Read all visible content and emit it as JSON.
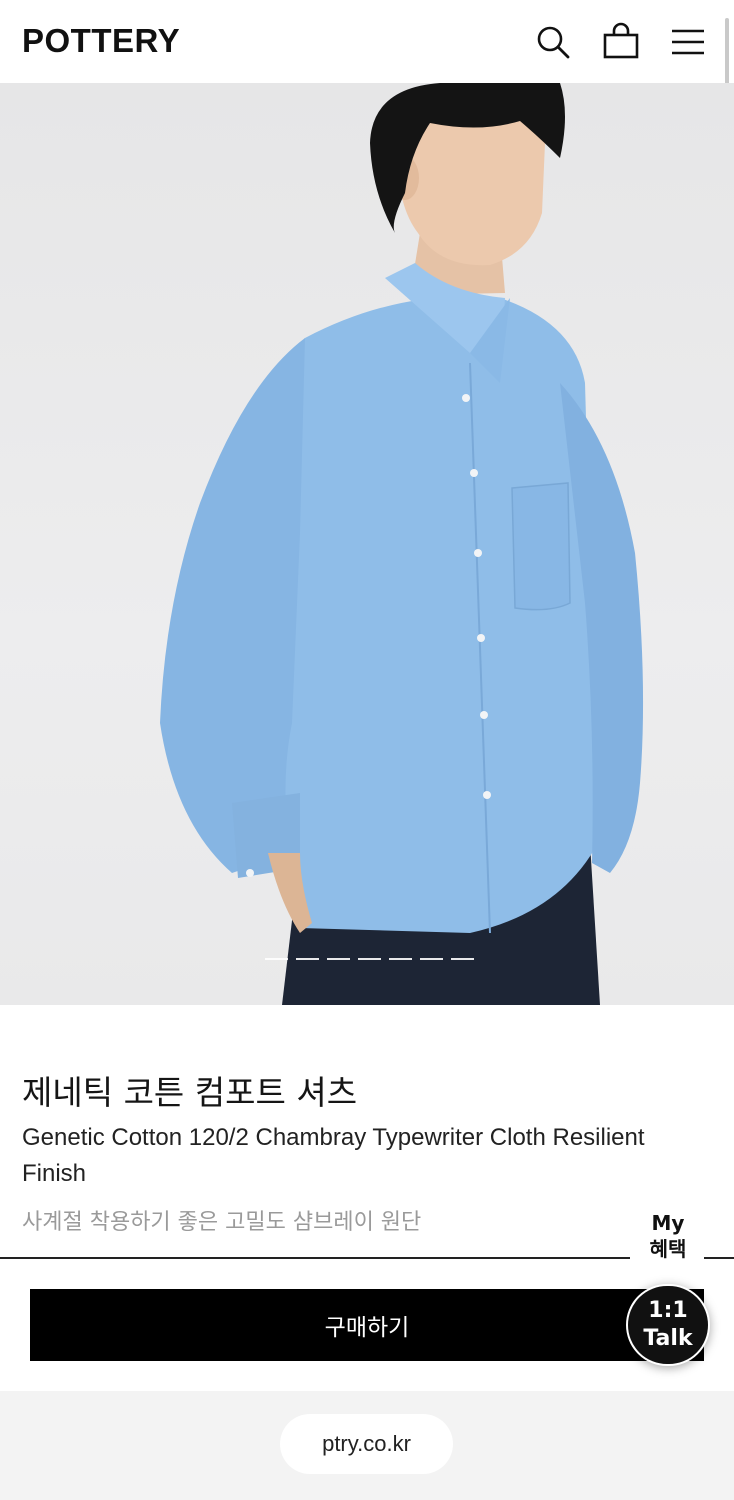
{
  "header": {
    "logo": "POTTERY",
    "icons": [
      "search-icon",
      "shopping-bag-icon",
      "hamburger-menu-icon"
    ]
  },
  "gallery": {
    "slide_count": 7,
    "active_index": 1
  },
  "product": {
    "name_ko": "제네틱 코튼 컴포트 셔츠",
    "name_en": "Genetic Cotton 120/2 Chambray Typewriter Cloth Resilient Finish",
    "description": "사계절 착용하기 좋은 고밀도 샴브레이 원단"
  },
  "floating": {
    "my_benefit_line1": "My",
    "my_benefit_line2": "혜택",
    "talk_line1": "1:1",
    "talk_line2": "Talk"
  },
  "actions": {
    "buy_label": "구매하기"
  },
  "footer": {
    "url": "ptry.co.kr"
  },
  "colors": {
    "shirt": "#8fbde8",
    "button_bg": "#000000",
    "desc_text": "#9a9a9a"
  }
}
